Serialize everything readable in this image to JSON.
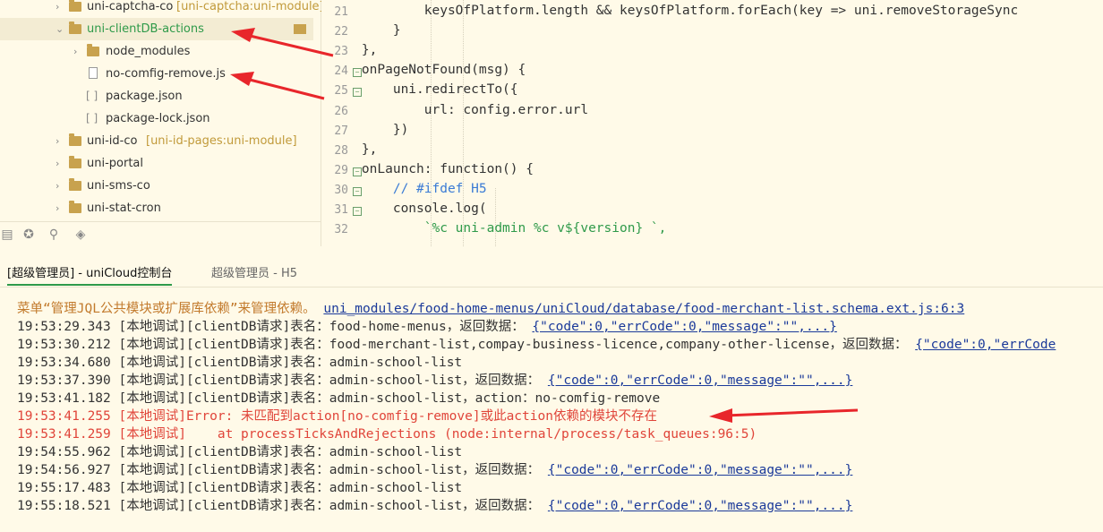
{
  "tree": {
    "items": [
      {
        "name": "uni-captcha-co",
        "sub": "[uni-captcha:uni-module]",
        "kind": "folder"
      },
      {
        "name": "uni-clientDB-actions",
        "sub": "",
        "kind": "folder-open"
      },
      {
        "name": "node_modules",
        "sub": "",
        "kind": "folder"
      },
      {
        "name": "no-comfig-remove.js",
        "sub": "",
        "kind": "file"
      },
      {
        "name": "package.json",
        "sub": "",
        "kind": "json"
      },
      {
        "name": "package-lock.json",
        "sub": "",
        "kind": "json"
      },
      {
        "name": "uni-id-co",
        "sub": "[uni-id-pages:uni-module]",
        "kind": "folder"
      },
      {
        "name": "uni-portal",
        "sub": "",
        "kind": "folder"
      },
      {
        "name": "uni-sms-co",
        "sub": "",
        "kind": "folder"
      },
      {
        "name": "uni-stat-cron",
        "sub": "",
        "kind": "folder"
      }
    ]
  },
  "editor": {
    "lines": [
      {
        "n": "21",
        "text": "            keysOfPlatform.length && keysOfPlatform.forEach(key => uni.removeStorageSync"
      },
      {
        "n": "22",
        "text": "        }"
      },
      {
        "n": "23",
        "text": "    },"
      },
      {
        "n": "24",
        "text": "    onPageNotFound(msg) {"
      },
      {
        "n": "25",
        "text": "        uni.redirectTo({"
      },
      {
        "n": "26",
        "text": "            url: config.error.url"
      },
      {
        "n": "27",
        "text": "        })"
      },
      {
        "n": "28",
        "text": "    },"
      },
      {
        "n": "29",
        "text": "    onLaunch: function() {"
      },
      {
        "n": "30",
        "text": "        // #ifdef H5"
      },
      {
        "n": "31",
        "text": "        console.log("
      },
      {
        "n": "32",
        "text": "            `%c uni-admin %c v${version} `,"
      }
    ]
  },
  "tabs": [
    {
      "label": "[超级管理员] - uniCloud控制台"
    },
    {
      "label": "超级管理员 - H5"
    }
  ],
  "console": {
    "lines": [
      {
        "text": "菜单“管理JQL公共模块或扩展库依赖”来管理依赖。 ",
        "link": "uni_modules/food-home-menus/uniCloud/database/food-merchant-list.schema.ext.js:6:3",
        "type": "warn"
      },
      {
        "text": "19:53:29.343 [本地调试][clientDB请求]表名：food-home-menus，返回数据： ",
        "link": "{\"code\":0,\"errCode\":0,\"message\":\"\",...}",
        "type": "normal"
      },
      {
        "text": "19:53:30.212 [本地调试][clientDB请求]表名：food-merchant-list,compay-business-licence,company-other-license，返回数据： ",
        "link": "{\"code\":0,\"errCode",
        "type": "normal"
      },
      {
        "text": "19:53:34.680 [本地调试][clientDB请求]表名：admin-school-list",
        "link": "",
        "type": "normal"
      },
      {
        "text": "19:53:37.390 [本地调试][clientDB请求]表名：admin-school-list，返回数据： ",
        "link": "{\"code\":0,\"errCode\":0,\"message\":\"\",...}",
        "type": "normal"
      },
      {
        "text": "19:53:41.182 [本地调试][clientDB请求]表名：admin-school-list，action：no-comfig-remove",
        "link": "",
        "type": "normal"
      },
      {
        "text": "19:53:41.255 [本地调试]Error: 未匹配到action[no-comfig-remove]或此action依赖的模块不存在",
        "link": "",
        "type": "err"
      },
      {
        "text": "19:53:41.259 [本地调试]    at processTicksAndRejections (node:internal/process/task_queues:96:5)",
        "link": "",
        "type": "err"
      },
      {
        "text": "19:54:55.962 [本地调试][clientDB请求]表名：admin-school-list",
        "link": "",
        "type": "normal"
      },
      {
        "text": "19:54:56.927 [本地调试][clientDB请求]表名：admin-school-list，返回数据： ",
        "link": "{\"code\":0,\"errCode\":0,\"message\":\"\",...}",
        "type": "normal"
      },
      {
        "text": "19:55:17.483 [本地调试][clientDB请求]表名：admin-school-list",
        "link": "",
        "type": "normal"
      },
      {
        "text": "19:55:18.521 [本地调试][clientDB请求]表名：admin-school-list，返回数据： ",
        "link": "{\"code\":0,\"errCode\":0,\"message\":\"\",...}",
        "type": "normal"
      }
    ]
  },
  "colors": {
    "arrow": "#e8262b",
    "error": "#e0453a",
    "warn": "#c27a2c",
    "link": "#1b3a9a",
    "bg": "#fffae8"
  }
}
